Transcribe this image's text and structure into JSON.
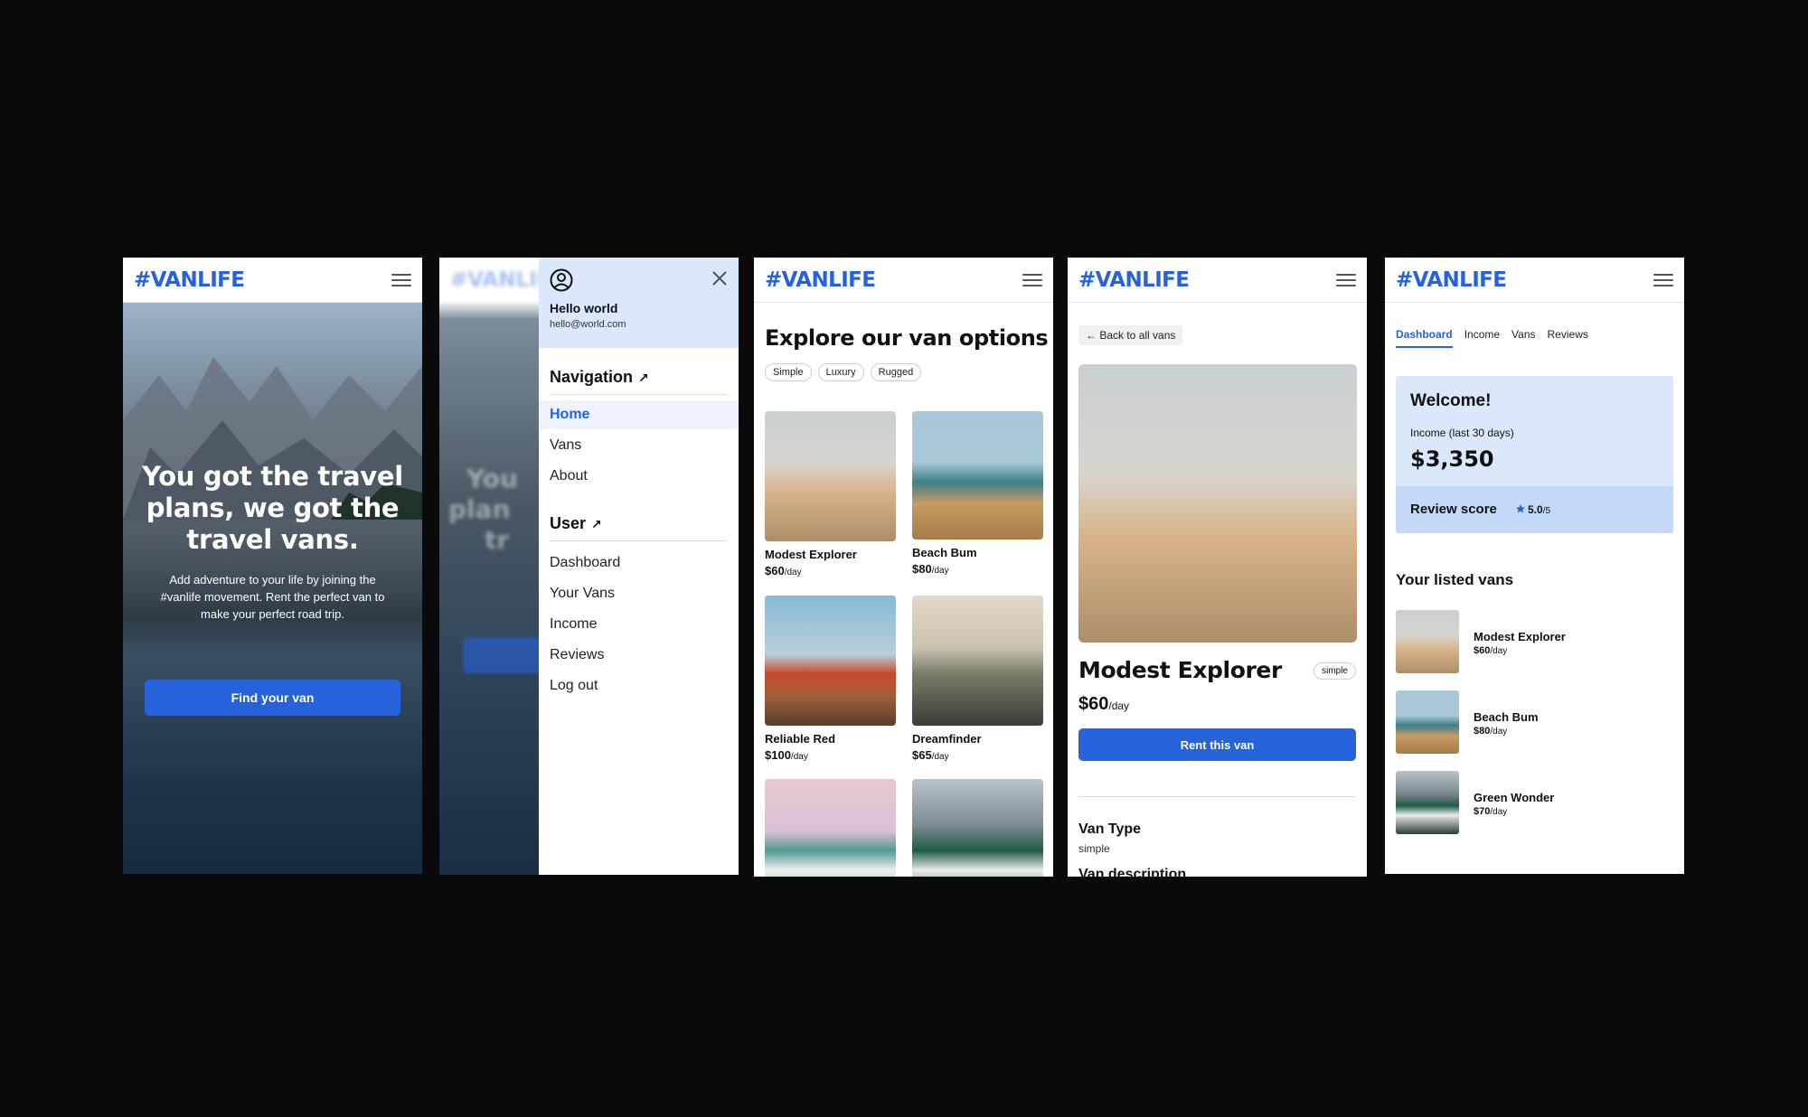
{
  "brand": "#VANLIFE",
  "colors": {
    "accent": "#2562dc",
    "light_blue": "#dbe7fb",
    "review_blue": "#c4d8f8",
    "background": "#0a0a0a"
  },
  "home": {
    "headline": "You got the travel plans, we got the travel vans.",
    "subtext": "Add adventure to your life by joining the #vanlife movement. Rent the perfect van to make your perfect road trip.",
    "cta": "Find your van"
  },
  "menu": {
    "blur_headline_1": "You",
    "blur_headline_2": "plan",
    "blur_headline_3": "tr",
    "user_name": "Hello world",
    "user_email": "hello@world.com",
    "nav_title": "Navigation",
    "nav_items": [
      "Home",
      "Vans",
      "About"
    ],
    "user_title": "User",
    "user_items": [
      "Dashboard",
      "Your Vans",
      "Income",
      "Reviews",
      "Log out"
    ],
    "arrow": "↗"
  },
  "vans_page": {
    "title": "Explore our van options",
    "filters": [
      "Simple",
      "Luxury",
      "Rugged"
    ],
    "per_day": "/day",
    "vans": [
      {
        "name": "Modest Explorer",
        "price": "$60"
      },
      {
        "name": "Beach Bum",
        "price": "$80"
      },
      {
        "name": "Reliable Red",
        "price": "$100"
      },
      {
        "name": "Dreamfinder",
        "price": "$65"
      },
      {
        "name": "",
        "price": ""
      },
      {
        "name": "",
        "price": ""
      }
    ]
  },
  "detail": {
    "back": "← Back to all vans",
    "name": "Modest Explorer",
    "badge": "simple",
    "price": "$60",
    "per_day": "/day",
    "rent": "Rent this van",
    "van_type_label": "Van Type",
    "van_type_value": "simple",
    "description_label": "Van description"
  },
  "dashboard": {
    "tabs": [
      "Dashboard",
      "Income",
      "Vans",
      "Reviews"
    ],
    "welcome": "Welcome!",
    "income_label": "Income (last 30 days)",
    "income_value": "$3,350",
    "review_label": "Review score",
    "review_score": "5.0",
    "review_max": "/5",
    "listed_title": "Your listed vans",
    "per_day": "/day",
    "listed": [
      {
        "name": "Modest Explorer",
        "price": "$60"
      },
      {
        "name": "Beach Bum",
        "price": "$80"
      },
      {
        "name": "Green Wonder",
        "price": "$70"
      }
    ]
  }
}
